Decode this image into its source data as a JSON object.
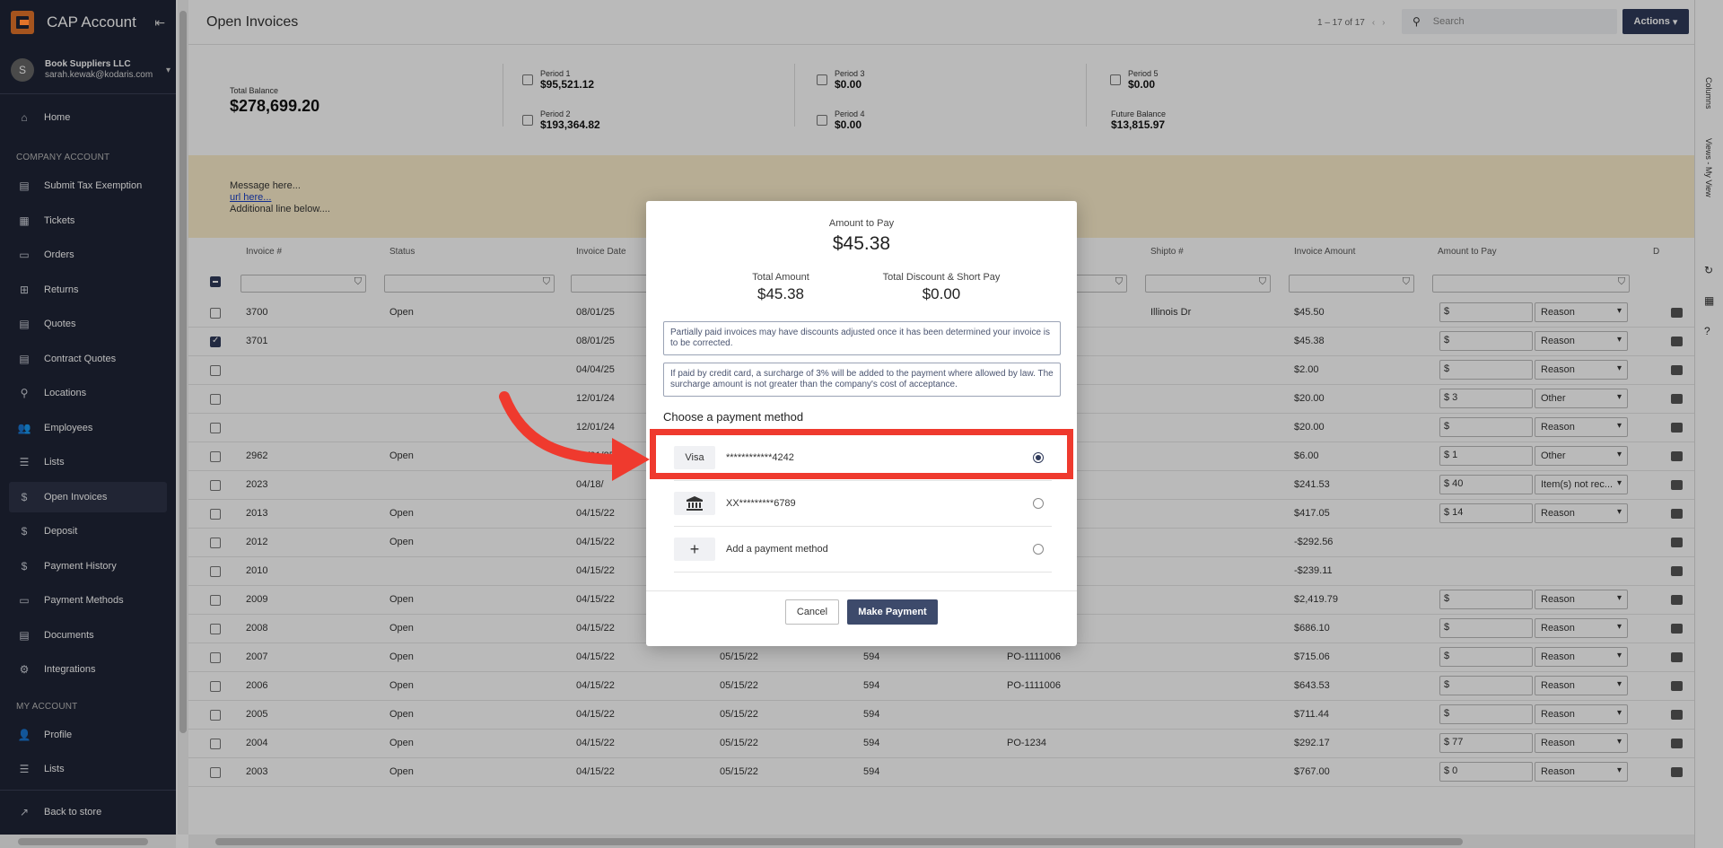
{
  "app": {
    "title": "CAP Account"
  },
  "account": {
    "avatar_letter": "S",
    "company": "Book Suppliers LLC",
    "email": "sarah.kewak@kodaris.com"
  },
  "sidebar": {
    "home": "Home",
    "company_group": "COMPANY ACCOUNT",
    "company_items": [
      "Submit Tax Exemption",
      "Tickets",
      "Orders",
      "Returns",
      "Quotes",
      "Contract Quotes",
      "Locations",
      "Employees",
      "Lists",
      "Open Invoices",
      "Deposit",
      "Payment History",
      "Payment Methods",
      "Documents",
      "Integrations"
    ],
    "my_group": "MY ACCOUNT",
    "my_items": [
      "Profile",
      "Lists"
    ],
    "back": "Back to store"
  },
  "header": {
    "title": "Open Invoices",
    "pager": "1 – 17 of 17",
    "search_placeholder": "Search",
    "actions": "Actions"
  },
  "balance": {
    "total_label": "Total Balance",
    "total_value": "$278,699.20",
    "periods": [
      {
        "label": "Period 1",
        "value": "$95,521.12"
      },
      {
        "label": "Period 2",
        "value": "$193,364.82"
      },
      {
        "label": "Period 3",
        "value": "$0.00"
      },
      {
        "label": "Period 4",
        "value": "$0.00"
      },
      {
        "label": "Period 5",
        "value": "$0.00"
      },
      {
        "label": "Future Balance",
        "value": "$13,815.97"
      }
    ]
  },
  "message": {
    "line1": "Message here...",
    "url": "url here...",
    "line3": "Additional line below...."
  },
  "table": {
    "columns": [
      "Invoice #",
      "Status",
      "Invoice Date",
      "Shipto #",
      "Invoice Amount",
      "Amount to Pay",
      "D"
    ],
    "rows": [
      {
        "inv": "3700",
        "status": "Open",
        "date": "08/01/25",
        "due": "",
        "num": "",
        "po": "",
        "ship": "Illinois Dr",
        "amt": "$45.50",
        "pay": "$",
        "reason": "Reason",
        "checked": false
      },
      {
        "inv": "3701",
        "status": "",
        "date": "08/01/25",
        "due": "",
        "num": "",
        "po": "",
        "ship": "",
        "amt": "$45.38",
        "pay": "$",
        "reason": "Reason",
        "checked": true
      },
      {
        "inv": "",
        "status": "",
        "date": "04/04/25",
        "due": "",
        "num": "",
        "po": "",
        "ship": "",
        "amt": "$2.00",
        "pay": "$",
        "reason": "Reason",
        "checked": false
      },
      {
        "inv": "",
        "status": "",
        "date": "12/01/24",
        "due": "",
        "num": "",
        "po": "",
        "ship": "",
        "amt": "$20.00",
        "pay": "$ 3",
        "reason": "Other",
        "checked": false
      },
      {
        "inv": "",
        "status": "",
        "date": "12/01/24",
        "due": "",
        "num": "",
        "po": "",
        "ship": "",
        "amt": "$20.00",
        "pay": "$",
        "reason": "Reason",
        "checked": false
      },
      {
        "inv": "2962",
        "status": "Open",
        "date": "03/31/25",
        "due": "",
        "num": "",
        "po": "",
        "ship": "",
        "amt": "$6.00",
        "pay": "$ 1",
        "reason": "Other",
        "checked": false
      },
      {
        "inv": "2023",
        "status": "",
        "date": "04/18/",
        "due": "",
        "num": "",
        "po": "",
        "ship": "",
        "amt": "$241.53",
        "pay": "$ 40",
        "reason": "Item(s) not rec...",
        "checked": false
      },
      {
        "inv": "2013",
        "status": "Open",
        "date": "04/15/22",
        "due": "",
        "num": "",
        "po": "",
        "ship": "",
        "amt": "$417.05",
        "pay": "$ 14",
        "reason": "Reason",
        "checked": false
      },
      {
        "inv": "2012",
        "status": "Open",
        "date": "04/15/22",
        "due": "",
        "num": "",
        "po": "",
        "ship": "",
        "amt": "-$292.56",
        "pay": "",
        "reason": "",
        "checked": false
      },
      {
        "inv": "2010",
        "status": "",
        "date": "04/15/22",
        "due": "",
        "num": "",
        "po": "",
        "ship": "",
        "amt": "-$239.11",
        "pay": "",
        "reason": "",
        "checked": false
      },
      {
        "inv": "2009",
        "status": "Open",
        "date": "04/15/22",
        "due": "",
        "num": "",
        "po": "",
        "ship": "",
        "amt": "$2,419.79",
        "pay": "$",
        "reason": "Reason",
        "checked": false
      },
      {
        "inv": "2008",
        "status": "Open",
        "date": "04/15/22",
        "due": "",
        "num": "",
        "po": "",
        "ship": "",
        "amt": "$686.10",
        "pay": "$",
        "reason": "Reason",
        "checked": false
      },
      {
        "inv": "2007",
        "status": "Open",
        "date": "04/15/22",
        "due": "05/15/22",
        "num": "594",
        "po": "PO-1111006",
        "ship": "",
        "amt": "$715.06",
        "pay": "$",
        "reason": "Reason",
        "checked": false
      },
      {
        "inv": "2006",
        "status": "Open",
        "date": "04/15/22",
        "due": "05/15/22",
        "num": "594",
        "po": "PO-1111006",
        "ship": "",
        "amt": "$643.53",
        "pay": "$",
        "reason": "Reason",
        "checked": false
      },
      {
        "inv": "2005",
        "status": "Open",
        "date": "04/15/22",
        "due": "05/15/22",
        "num": "594",
        "po": "",
        "ship": "",
        "amt": "$711.44",
        "pay": "$",
        "reason": "Reason",
        "checked": false
      },
      {
        "inv": "2004",
        "status": "Open",
        "date": "04/15/22",
        "due": "05/15/22",
        "num": "594",
        "po": "PO-1234",
        "ship": "",
        "amt": "$292.17",
        "pay": "$ 77",
        "reason": "Reason",
        "checked": false
      },
      {
        "inv": "2003",
        "status": "Open",
        "date": "04/15/22",
        "due": "05/15/22",
        "num": "594",
        "po": "",
        "ship": "",
        "amt": "$767.00",
        "pay": "$ 0",
        "reason": "Reason",
        "checked": false
      }
    ]
  },
  "right_panel": {
    "columns": "Columns",
    "views": "Views - My View"
  },
  "modal": {
    "amount_label": "Amount to Pay",
    "amount_value": "$45.38",
    "total_label": "Total Amount",
    "total_value": "$45.38",
    "discount_label": "Total Discount & Short Pay",
    "discount_value": "$0.00",
    "notice1": "Partially paid invoices may have discounts adjusted once it has been determined your invoice is to be corrected.",
    "notice2": "If paid by credit card, a surcharge of 3% will be added to the payment where allowed by law. The surcharge amount is not greater than the company's cost of acceptance.",
    "choose": "Choose a payment method",
    "methods": [
      {
        "badge": "Visa",
        "text": "************4242",
        "selected": true
      },
      {
        "badge": "bank-icon",
        "text": "XX*********6789",
        "selected": false
      },
      {
        "badge": "plus-icon",
        "text": "Add a payment method",
        "selected": false
      }
    ],
    "cancel": "Cancel",
    "pay": "Make Payment"
  },
  "colors": {
    "sidebar": "#1f2436",
    "accent": "#2f3a5a",
    "highlight": "#ef3a2e",
    "message_bg": "#fbeecb"
  }
}
